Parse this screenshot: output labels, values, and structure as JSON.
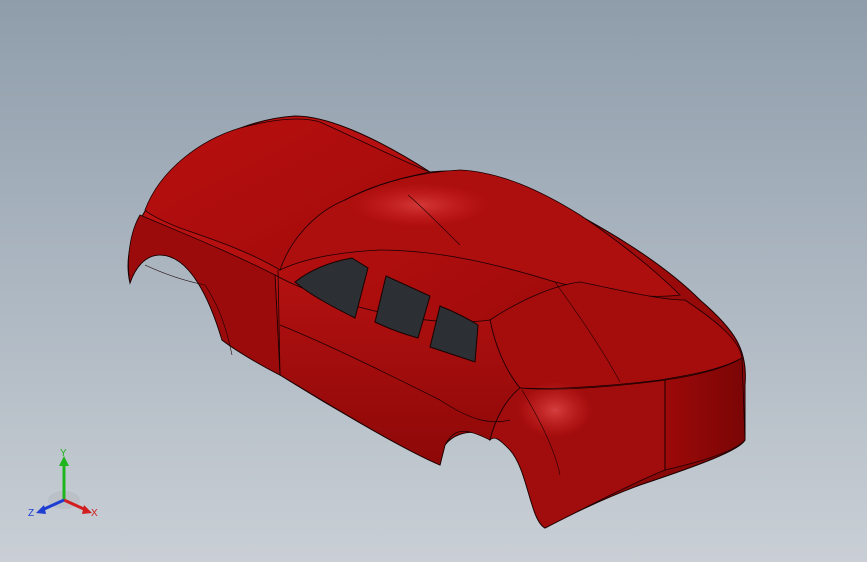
{
  "viewport": {
    "background_top": "#8f9dab",
    "background_bottom": "#c9cfd5"
  },
  "model": {
    "body_color": "#b00d0d",
    "window_color": "#2c2f33",
    "edge_color": "#1a0000"
  },
  "triad": {
    "x_label": "X",
    "y_label": "Y",
    "z_label": "Z",
    "x_color": "#d21e1e",
    "y_color": "#1fb51f",
    "z_color": "#1e3ed2"
  }
}
